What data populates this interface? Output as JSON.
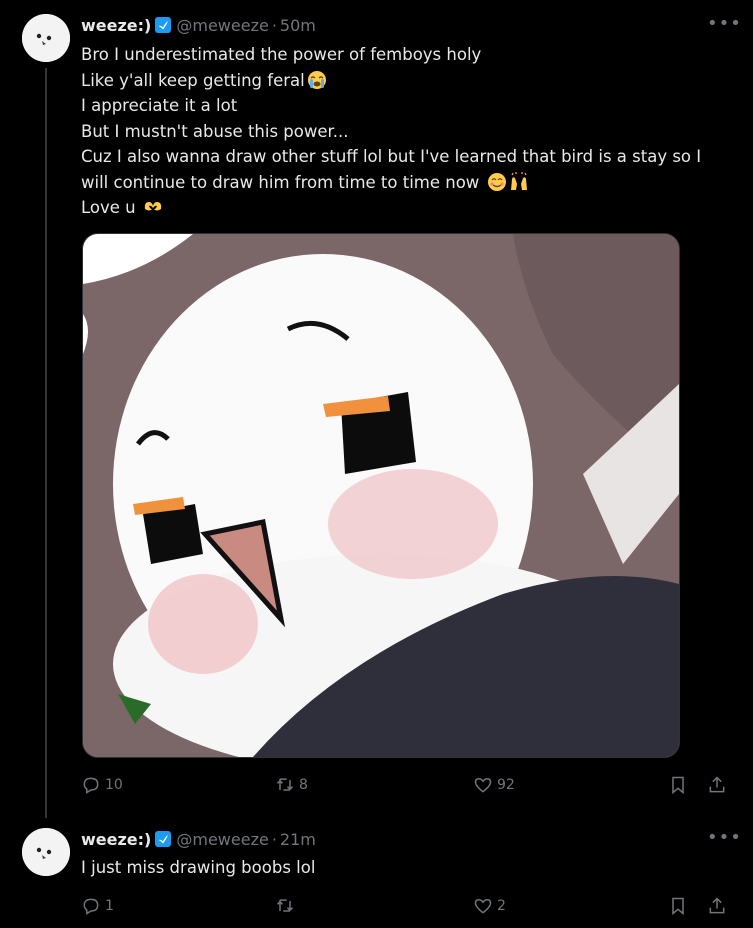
{
  "tweets": [
    {
      "name": "weeze:)",
      "handle": "@meweeze",
      "time": "50m",
      "lines": [
        "Bro I underestimated the power of femboys holy",
        "Like y'all keep getting feral",
        "I appreciate it a lot",
        "But I mustn't abuse this power...",
        "Cuz I also wanna draw other stuff lol but I've learned that bird is a stay so I",
        "will continue to draw him from time to time now",
        "Love u"
      ],
      "replies": "10",
      "retweets": "8",
      "likes": "92"
    },
    {
      "name": "weeze:)",
      "handle": "@meweeze",
      "time": "21m",
      "lines": [
        "I just miss drawing boobs lol"
      ],
      "replies": "1",
      "retweets": "",
      "likes": "2"
    }
  ],
  "icons": {
    "verified": "verified-badge-icon",
    "more": "more-options-icon",
    "reply": "reply-icon",
    "retweet": "retweet-icon",
    "like": "heart-icon",
    "bookmark": "bookmark-icon",
    "share": "share-icon"
  },
  "colors": {
    "background": "#000000",
    "muted": "#71767b",
    "verified": "#1d9bf0"
  }
}
